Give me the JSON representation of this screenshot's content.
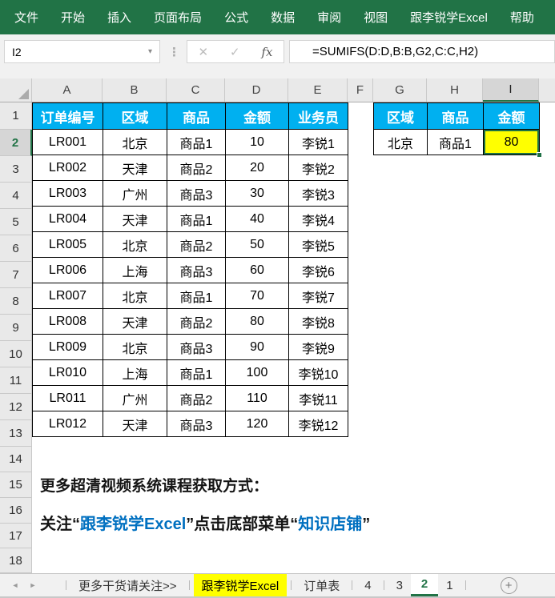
{
  "ribbon": {
    "items": [
      "文件",
      "开始",
      "插入",
      "页面布局",
      "公式",
      "数据",
      "审阅",
      "视图",
      "跟李锐学Excel",
      "帮助"
    ]
  },
  "formula_bar": {
    "name_box": "I2",
    "dropdown": "▾",
    "dots": "⋮",
    "cancel": "✕",
    "confirm": "✓",
    "fx": "fx",
    "formula": "=SUMIFS(D:D,B:B,G2,C:C,H2)"
  },
  "grid": {
    "col_letters": [
      "A",
      "B",
      "C",
      "D",
      "E",
      "F",
      "G",
      "H",
      "I"
    ],
    "row_numbers": [
      "1",
      "2",
      "3",
      "4",
      "5",
      "6",
      "7",
      "8",
      "9",
      "10",
      "11",
      "12",
      "13",
      "14",
      "15",
      "16",
      "17",
      "18"
    ],
    "selected_column": "I",
    "selected_row": "2",
    "left_table": {
      "headers": [
        "订单编号",
        "区域",
        "商品",
        "金额",
        "业务员"
      ],
      "rows": [
        [
          "LR001",
          "北京",
          "商品1",
          "10",
          "李锐1"
        ],
        [
          "LR002",
          "天津",
          "商品2",
          "20",
          "李锐2"
        ],
        [
          "LR003",
          "广州",
          "商品3",
          "30",
          "李锐3"
        ],
        [
          "LR004",
          "天津",
          "商品1",
          "40",
          "李锐4"
        ],
        [
          "LR005",
          "北京",
          "商品2",
          "50",
          "李锐5"
        ],
        [
          "LR006",
          "上海",
          "商品3",
          "60",
          "李锐6"
        ],
        [
          "LR007",
          "北京",
          "商品1",
          "70",
          "李锐7"
        ],
        [
          "LR008",
          "天津",
          "商品2",
          "80",
          "李锐8"
        ],
        [
          "LR009",
          "北京",
          "商品3",
          "90",
          "李锐9"
        ],
        [
          "LR010",
          "上海",
          "商品1",
          "100",
          "李锐10"
        ],
        [
          "LR011",
          "广州",
          "商品2",
          "110",
          "李锐11"
        ],
        [
          "LR012",
          "天津",
          "商品3",
          "120",
          "李锐12"
        ]
      ]
    },
    "right_table": {
      "headers": [
        "区域",
        "商品",
        "金额"
      ],
      "values": [
        "北京",
        "商品1",
        "80"
      ]
    },
    "active_cell_ref": "I2",
    "notes": {
      "line1": "更多超清视频系统课程获取方式：",
      "line2_seg1": "关注“",
      "line2_seg2": "跟李锐学Excel",
      "line2_seg3": "”点击底部菜单“",
      "line2_seg4": "知识店铺",
      "line2_seg5": "”"
    }
  },
  "colors": {
    "ribbon_green": "#217346",
    "header_blue": "#00B0F0",
    "highlight_yellow": "#FFFF00",
    "selection_green": "#1E7145",
    "link_blue": "#0070C0"
  },
  "sheet_bar": {
    "prev": "◄",
    "next": "►",
    "add": "+",
    "tabs": [
      {
        "label": "更多干货请关注>>"
      },
      {
        "label": "跟李锐学Excel"
      },
      {
        "label": "订单表"
      },
      {
        "label": "4"
      },
      {
        "label": "3"
      },
      {
        "label": "2"
      },
      {
        "label": "1"
      }
    ]
  }
}
